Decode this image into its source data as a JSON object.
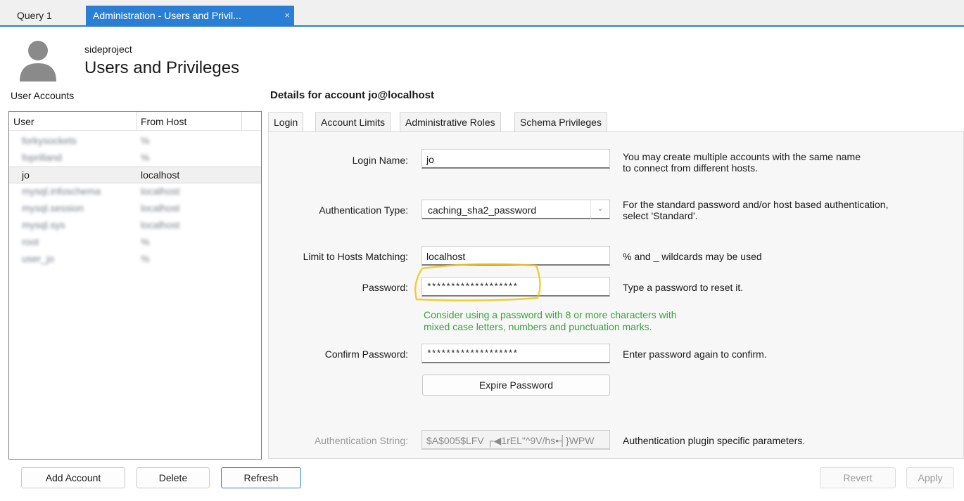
{
  "query_tabs": [
    {
      "label": "Query 1",
      "active": false
    },
    {
      "label": "Administration - Users and Privil...",
      "active": true,
      "close": "×"
    }
  ],
  "header": {
    "schema": "sideproject",
    "title": "Users and Privileges",
    "icon": "user-avatar-icon"
  },
  "user_accounts": {
    "label": "User Accounts",
    "columns": [
      "User",
      "From Host"
    ],
    "rows": [
      {
        "user": "forkysockets",
        "host": "%",
        "redacted": true
      },
      {
        "user": "foprilland",
        "host": "%",
        "redacted": true
      },
      {
        "user": "jo",
        "host": "localhost",
        "selected": true
      },
      {
        "user": "mysql.infoschema",
        "host": "localhost",
        "redacted": true
      },
      {
        "user": "mysql.session",
        "host": "localhost",
        "redacted": true
      },
      {
        "user": "mysql.sys",
        "host": "localhost",
        "redacted": true
      },
      {
        "user": "root",
        "host": "%",
        "redacted": true
      },
      {
        "user": "user_jo",
        "host": "%",
        "redacted": true
      }
    ]
  },
  "details": {
    "title": "Details for account jo@localhost",
    "tabs": [
      "Login",
      "Account Limits",
      "Administrative Roles",
      "Schema Privileges"
    ],
    "active_tab": "Login",
    "login_name": {
      "label": "Login Name:",
      "value": "jo",
      "help": [
        "You may create multiple accounts with the same name",
        "to connect from different hosts."
      ]
    },
    "auth_type": {
      "label": "Authentication Type:",
      "value": "caching_sha2_password",
      "help": [
        "For the standard password and/or host based authentication,",
        "select 'Standard'."
      ]
    },
    "hosts": {
      "label": "Limit to Hosts Matching:",
      "value": "localhost",
      "help": "% and _ wildcards may be used"
    },
    "password": {
      "label": "Password:",
      "value": "*******************",
      "help": "Type a password to reset it."
    },
    "password_hint": [
      "Consider using a password with 8 or more characters with",
      "mixed case letters, numbers and punctuation marks."
    ],
    "confirm": {
      "label": "Confirm Password:",
      "value": "*******************",
      "help": "Enter password again to confirm."
    },
    "expire_button": "Expire Password",
    "auth_string": {
      "label": "Authentication String:",
      "value": "$A$005$LFV ┌◀1rEL\"^9V/hs•┤}WPW",
      "help": "Authentication plugin specific parameters."
    }
  },
  "buttons": {
    "add": "Add Account",
    "delete": "Delete",
    "refresh": "Refresh",
    "revert": "Revert",
    "apply": "Apply"
  },
  "colors": {
    "accent": "#2a7fd4",
    "hint_green": "#36a43a",
    "highlight": "#f0c419"
  }
}
